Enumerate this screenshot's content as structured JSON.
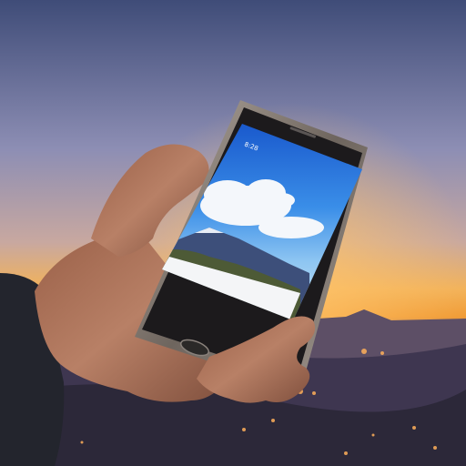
{
  "scene": {
    "description_tags": [
      "hand",
      "smartphone",
      "sunset-sky",
      "mountain-wallpaper",
      "city-lights"
    ],
    "colors": {
      "sky_top": "#4d5a86",
      "sky_mid": "#9a8cb0",
      "horizon_glow": "#f5a63a",
      "horizon_orange": "#e8772a",
      "ground_dark": "#2b2838",
      "phone_frame": "#7c736b",
      "phone_bezel": "#1c1a1c",
      "screen_sky": "#1f6fd6",
      "cloud": "#f4f7fb",
      "mountain": "#3d4f7a",
      "forest": "#4d5a36",
      "card": "#f4f5f7",
      "skin": "#a86f55",
      "sleeve": "#23252d"
    }
  },
  "phone": {
    "status_left": "8:28",
    "status_right": "",
    "header_sub": "",
    "action_icon": "",
    "widget": {
      "row1_left": "",
      "row2_left": "",
      "row2_mid": "",
      "row3_mid": "",
      "row3_right": ""
    }
  }
}
